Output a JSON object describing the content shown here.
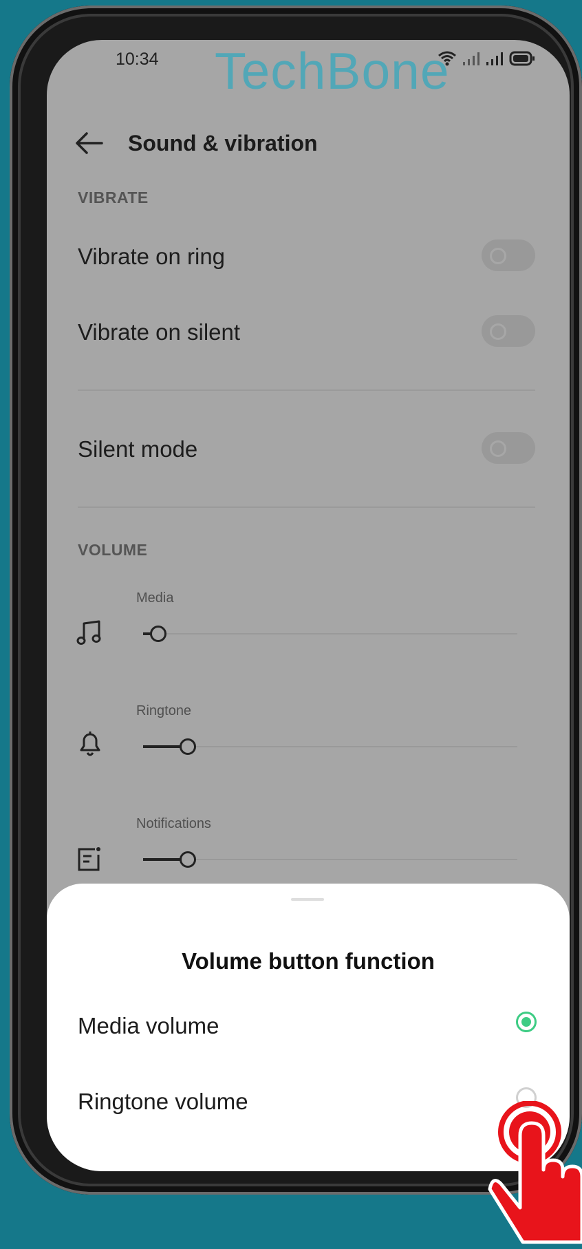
{
  "status_bar": {
    "time": "10:34"
  },
  "watermark": "TechBone",
  "header": {
    "title": "Sound & vibration"
  },
  "vibrate": {
    "section_label": "VIBRATE",
    "items": [
      {
        "label": "Vibrate on ring",
        "enabled": false
      },
      {
        "label": "Vibrate on silent",
        "enabled": false
      }
    ]
  },
  "silent_mode": {
    "label": "Silent mode",
    "enabled": false
  },
  "volume": {
    "section_label": "VOLUME",
    "sliders": [
      {
        "label": "Media",
        "icon": "music-note-icon",
        "level": 0.04
      },
      {
        "label": "Ringtone",
        "icon": "bell-icon",
        "level": 0.12
      },
      {
        "label": "Notifications",
        "icon": "notification-icon",
        "level": 0.12
      }
    ]
  },
  "sheet": {
    "title": "Volume button function",
    "options": [
      {
        "label": "Media volume",
        "selected": true
      },
      {
        "label": "Ringtone volume",
        "selected": false
      }
    ]
  },
  "colors": {
    "background": "#15788a",
    "accent": "#3dcc84",
    "pointer": "#e8141b"
  }
}
